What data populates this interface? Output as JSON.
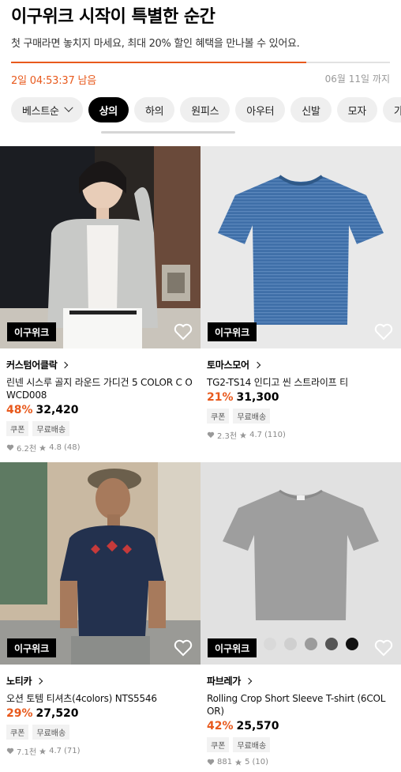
{
  "header": {
    "title": "이구위크 시작이 특별한 순간",
    "subtitle": "첫 구매라면 놓치지 마세요, 최대 20% 할인 혜택을 만나볼 수 있어요.",
    "progress": 0.78,
    "timer": "2일 04:53:37 남음",
    "deadline": "06월 11일 까지"
  },
  "chips": {
    "sort": "베스트순",
    "items": [
      "상의",
      "하의",
      "원피스",
      "아우터",
      "신발",
      "모자",
      "가방"
    ],
    "active": "상의"
  },
  "products": [
    {
      "badge": "이구위크",
      "brand": "커스텀어클락",
      "name": "린넨 시스루 골지 라운드 가디건 5 COLOR C OWCD008",
      "discount": "48%",
      "price": "32,420",
      "tags": [
        "쿠폰",
        "무료배송"
      ],
      "likes": "6.2천",
      "rating": "4.8",
      "reviews": "(48)"
    },
    {
      "badge": "이구위크",
      "brand": "토마스모어",
      "name": "TG2-TS14 인디고 씬 스트라이프 티",
      "discount": "21%",
      "price": "31,300",
      "tags": [
        "쿠폰",
        "무료배송"
      ],
      "likes": "2.3천",
      "rating": "4.7",
      "reviews": "(110)"
    },
    {
      "badge": "이구위크",
      "brand": "노티카",
      "name": "오션 토템 티셔츠(4colors) NTS5546",
      "discount": "29%",
      "price": "27,520",
      "tags": [
        "쿠폰",
        "무료배송"
      ],
      "likes": "7.1천",
      "rating": "4.7",
      "reviews": "(71)"
    },
    {
      "badge": "이구위크",
      "brand": "파브레가",
      "name": "Rolling Crop Short Sleeve T-shirt (6COL OR)",
      "discount": "42%",
      "price": "25,570",
      "tags": [
        "쿠폰",
        "무료배송"
      ],
      "likes": "881",
      "rating": "5",
      "reviews": "(10)",
      "swatches": [
        "#d9d9d9",
        "#cfcfcf",
        "#9b9b9b",
        "#555555",
        "#111111"
      ]
    }
  ],
  "colors": {
    "accent": "#e8591c",
    "badge_bg": "#000000"
  }
}
